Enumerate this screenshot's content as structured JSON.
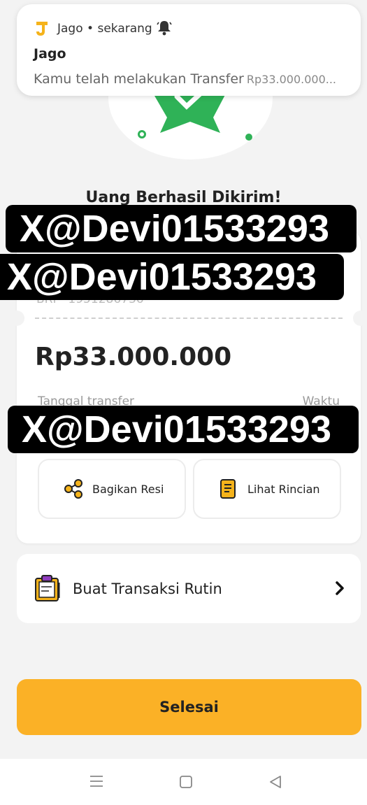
{
  "notification": {
    "app_name": "Jago",
    "time": "sekarang",
    "separator": "•",
    "title": "Jago",
    "body": "Kamu telah melakukan Transfer",
    "body_amount": "Rp33.000.000..."
  },
  "headline": "Uang Berhasil Dikirim!",
  "card": {
    "account": "BRI - 1951286736",
    "amount": "Rp33.000.000",
    "date_label": "Tanggal transfer",
    "time_label": "Waktu",
    "share_label": "Bagikan Resi",
    "details_label": "Lihat Rincian"
  },
  "routine": {
    "label": "Buat Transaksi Rutin"
  },
  "finish_label": "Selesai",
  "watermarks": [
    "X@Devi01533293",
    "X@Devi01533293",
    "X@Devi01533293"
  ],
  "colors": {
    "accent": "#fbb126",
    "success_green": "#2fb257",
    "brand_yellow": "#f5b31b"
  },
  "icons": [
    "jago-logo-icon",
    "bell-icon",
    "star-check-icon",
    "share-icon",
    "receipt-icon",
    "clipboard-icon",
    "chevron-right-icon",
    "menu-icon",
    "home-icon",
    "back-icon"
  ]
}
